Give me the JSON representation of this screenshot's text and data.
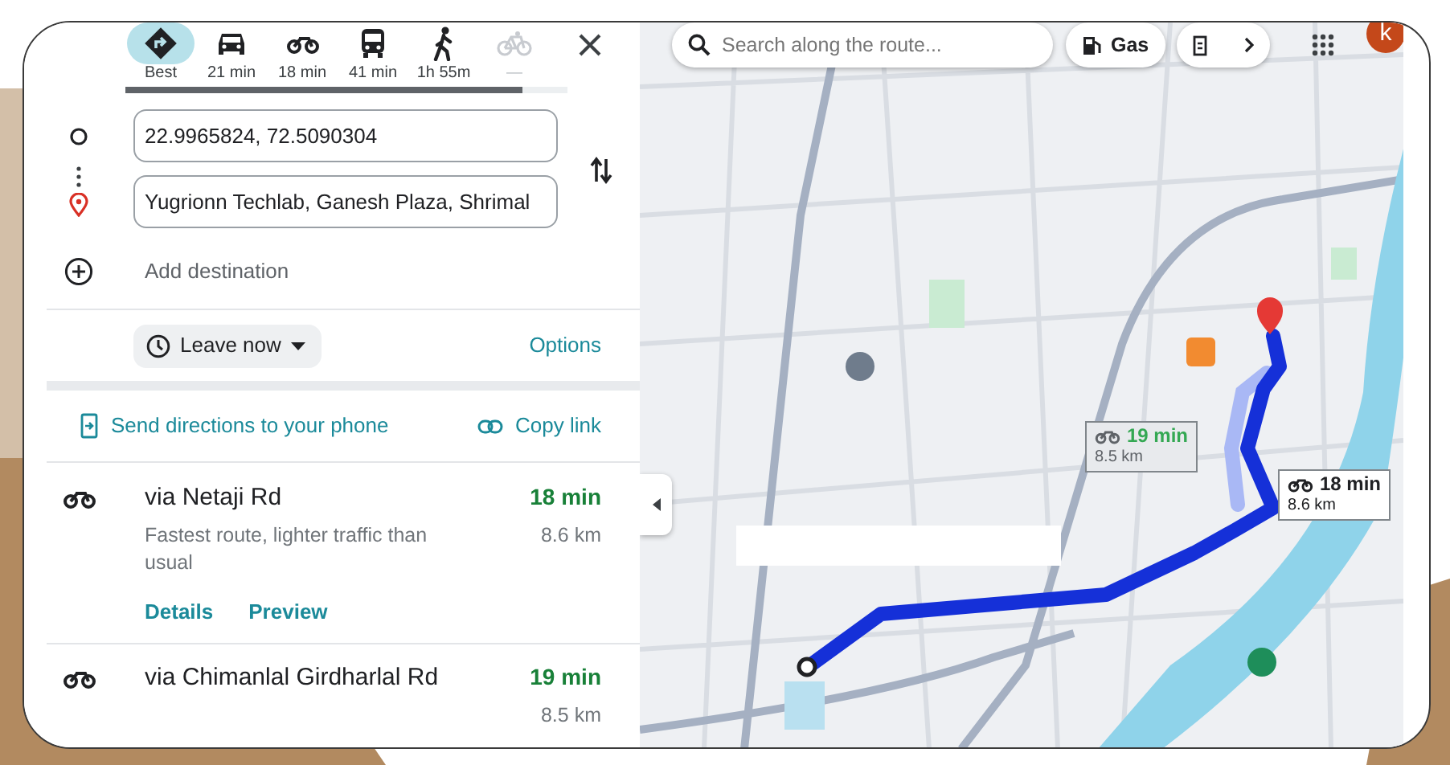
{
  "travel_modes": [
    {
      "kind": "best",
      "label": "Best",
      "selected": true,
      "disabled": false
    },
    {
      "kind": "car",
      "label": "21 min",
      "selected": false,
      "disabled": false
    },
    {
      "kind": "motorbike",
      "label": "18 min",
      "selected": false,
      "disabled": false
    },
    {
      "kind": "transit",
      "label": "41 min",
      "selected": false,
      "disabled": false
    },
    {
      "kind": "walk",
      "label": "1h 55m",
      "selected": false,
      "disabled": false
    },
    {
      "kind": "bicycle",
      "label": "—",
      "selected": false,
      "disabled": true
    }
  ],
  "origin": {
    "value": "22.9965824, 72.5090304"
  },
  "destination": {
    "value": "Yugrionn Techlab, Ganesh Plaza, Shrimal"
  },
  "add_destination": "Add destination",
  "leave_button": "Leave now",
  "options_link": "Options",
  "send_link": "Send directions to your phone",
  "copy_link": "Copy link",
  "routes": [
    {
      "name": "via Netaji Rd",
      "duration": "18 min",
      "distance": "8.6 km",
      "description": "Fastest route, lighter traffic than usual",
      "links": [
        "Details",
        "Preview"
      ]
    },
    {
      "name": "via Chimanlal Girdharlal Rd",
      "duration": "19 min",
      "distance": "8.5 km"
    }
  ],
  "map": {
    "kind": "picture",
    "search": {
      "placeholder": "Search along the route..."
    },
    "chips": [
      {
        "kind": "gas",
        "label": "Gas"
      },
      {
        "kind": "charging"
      }
    ],
    "avatar": "k",
    "callouts": [
      {
        "duration": "19 min",
        "distance": "8.5 km",
        "selected": false
      },
      {
        "duration": "18 min",
        "distance": "8.6 km",
        "selected": true
      }
    ]
  }
}
